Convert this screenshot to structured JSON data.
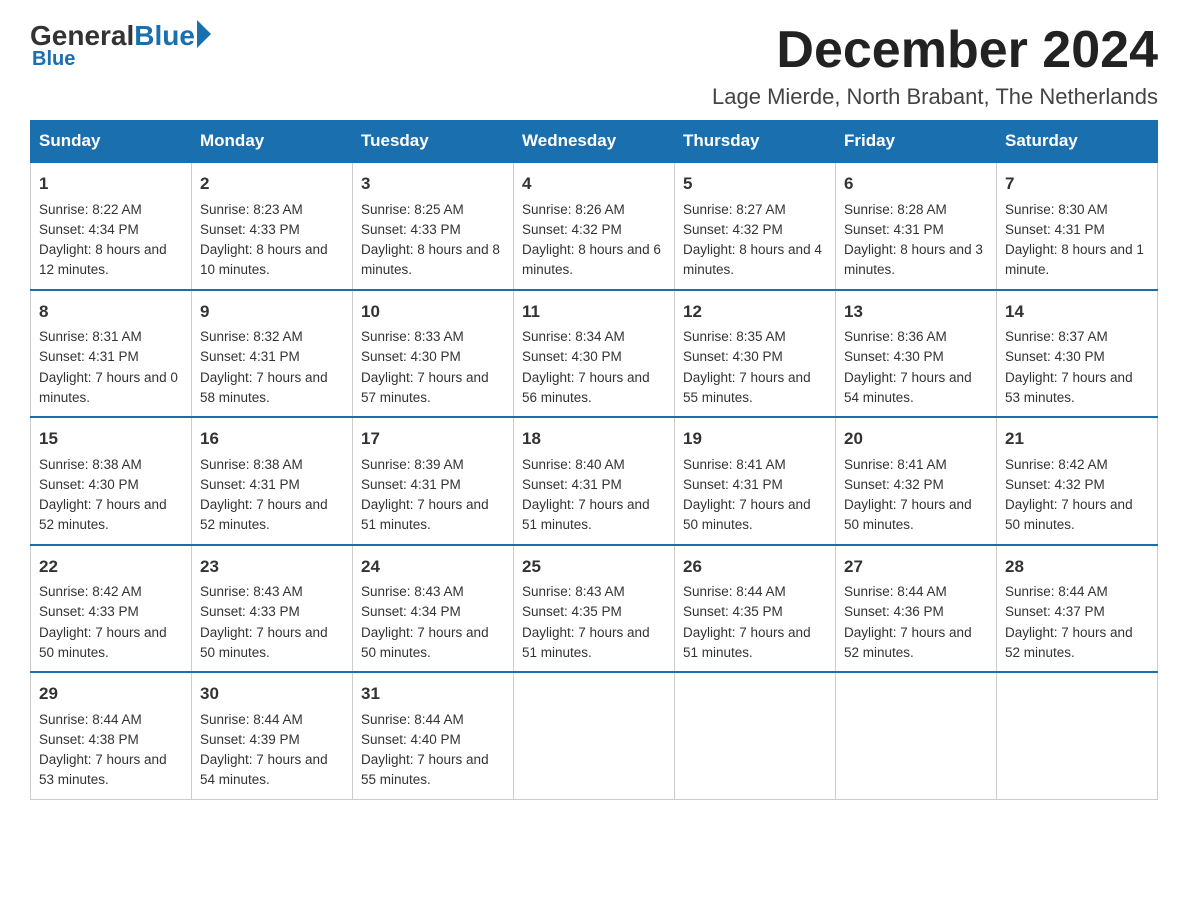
{
  "header": {
    "logo": {
      "general": "General",
      "blue": "Blue",
      "underline": "Blue"
    },
    "title": "December 2024",
    "subtitle": "Lage Mierde, North Brabant, The Netherlands"
  },
  "calendar": {
    "days_of_week": [
      "Sunday",
      "Monday",
      "Tuesday",
      "Wednesday",
      "Thursday",
      "Friday",
      "Saturday"
    ],
    "weeks": [
      [
        {
          "day": "1",
          "sunrise": "8:22 AM",
          "sunset": "4:34 PM",
          "daylight": "8 hours and 12 minutes."
        },
        {
          "day": "2",
          "sunrise": "8:23 AM",
          "sunset": "4:33 PM",
          "daylight": "8 hours and 10 minutes."
        },
        {
          "day": "3",
          "sunrise": "8:25 AM",
          "sunset": "4:33 PM",
          "daylight": "8 hours and 8 minutes."
        },
        {
          "day": "4",
          "sunrise": "8:26 AM",
          "sunset": "4:32 PM",
          "daylight": "8 hours and 6 minutes."
        },
        {
          "day": "5",
          "sunrise": "8:27 AM",
          "sunset": "4:32 PM",
          "daylight": "8 hours and 4 minutes."
        },
        {
          "day": "6",
          "sunrise": "8:28 AM",
          "sunset": "4:31 PM",
          "daylight": "8 hours and 3 minutes."
        },
        {
          "day": "7",
          "sunrise": "8:30 AM",
          "sunset": "4:31 PM",
          "daylight": "8 hours and 1 minute."
        }
      ],
      [
        {
          "day": "8",
          "sunrise": "8:31 AM",
          "sunset": "4:31 PM",
          "daylight": "7 hours and 0 minutes."
        },
        {
          "day": "9",
          "sunrise": "8:32 AM",
          "sunset": "4:31 PM",
          "daylight": "7 hours and 58 minutes."
        },
        {
          "day": "10",
          "sunrise": "8:33 AM",
          "sunset": "4:30 PM",
          "daylight": "7 hours and 57 minutes."
        },
        {
          "day": "11",
          "sunrise": "8:34 AM",
          "sunset": "4:30 PM",
          "daylight": "7 hours and 56 minutes."
        },
        {
          "day": "12",
          "sunrise": "8:35 AM",
          "sunset": "4:30 PM",
          "daylight": "7 hours and 55 minutes."
        },
        {
          "day": "13",
          "sunrise": "8:36 AM",
          "sunset": "4:30 PM",
          "daylight": "7 hours and 54 minutes."
        },
        {
          "day": "14",
          "sunrise": "8:37 AM",
          "sunset": "4:30 PM",
          "daylight": "7 hours and 53 minutes."
        }
      ],
      [
        {
          "day": "15",
          "sunrise": "8:38 AM",
          "sunset": "4:30 PM",
          "daylight": "7 hours and 52 minutes."
        },
        {
          "day": "16",
          "sunrise": "8:38 AM",
          "sunset": "4:31 PM",
          "daylight": "7 hours and 52 minutes."
        },
        {
          "day": "17",
          "sunrise": "8:39 AM",
          "sunset": "4:31 PM",
          "daylight": "7 hours and 51 minutes."
        },
        {
          "day": "18",
          "sunrise": "8:40 AM",
          "sunset": "4:31 PM",
          "daylight": "7 hours and 51 minutes."
        },
        {
          "day": "19",
          "sunrise": "8:41 AM",
          "sunset": "4:31 PM",
          "daylight": "7 hours and 50 minutes."
        },
        {
          "day": "20",
          "sunrise": "8:41 AM",
          "sunset": "4:32 PM",
          "daylight": "7 hours and 50 minutes."
        },
        {
          "day": "21",
          "sunrise": "8:42 AM",
          "sunset": "4:32 PM",
          "daylight": "7 hours and 50 minutes."
        }
      ],
      [
        {
          "day": "22",
          "sunrise": "8:42 AM",
          "sunset": "4:33 PM",
          "daylight": "7 hours and 50 minutes."
        },
        {
          "day": "23",
          "sunrise": "8:43 AM",
          "sunset": "4:33 PM",
          "daylight": "7 hours and 50 minutes."
        },
        {
          "day": "24",
          "sunrise": "8:43 AM",
          "sunset": "4:34 PM",
          "daylight": "7 hours and 50 minutes."
        },
        {
          "day": "25",
          "sunrise": "8:43 AM",
          "sunset": "4:35 PM",
          "daylight": "7 hours and 51 minutes."
        },
        {
          "day": "26",
          "sunrise": "8:44 AM",
          "sunset": "4:35 PM",
          "daylight": "7 hours and 51 minutes."
        },
        {
          "day": "27",
          "sunrise": "8:44 AM",
          "sunset": "4:36 PM",
          "daylight": "7 hours and 52 minutes."
        },
        {
          "day": "28",
          "sunrise": "8:44 AM",
          "sunset": "4:37 PM",
          "daylight": "7 hours and 52 minutes."
        }
      ],
      [
        {
          "day": "29",
          "sunrise": "8:44 AM",
          "sunset": "4:38 PM",
          "daylight": "7 hours and 53 minutes."
        },
        {
          "day": "30",
          "sunrise": "8:44 AM",
          "sunset": "4:39 PM",
          "daylight": "7 hours and 54 minutes."
        },
        {
          "day": "31",
          "sunrise": "8:44 AM",
          "sunset": "4:40 PM",
          "daylight": "7 hours and 55 minutes."
        },
        null,
        null,
        null,
        null
      ]
    ],
    "labels": {
      "sunrise": "Sunrise:",
      "sunset": "Sunset:",
      "daylight": "Daylight:"
    }
  }
}
